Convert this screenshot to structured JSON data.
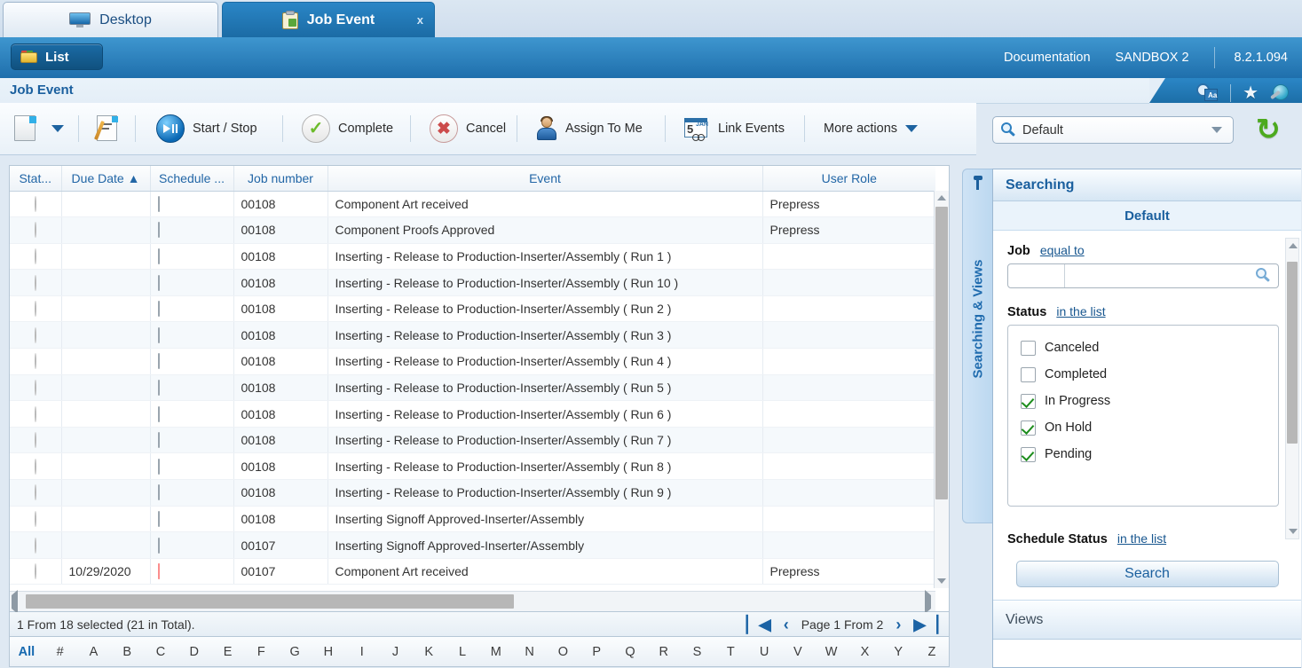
{
  "tabs": [
    {
      "label": "Desktop",
      "icon": "monitor-icon",
      "active": false
    },
    {
      "label": "Job Event",
      "icon": "clipboard-icon",
      "active": true,
      "close": "x"
    }
  ],
  "header": {
    "list_button": "List",
    "documentation": "Documentation",
    "environment": "SANDBOX 2",
    "version": "8.2.1.094",
    "page_title": "Job Event"
  },
  "toolbar": {
    "new_dropdown": "▼",
    "items": [
      {
        "label": "Start / Stop",
        "icon": "start-stop-icon"
      },
      {
        "label": "Complete",
        "icon": "check-circle-icon"
      },
      {
        "label": "Cancel",
        "icon": "cancel-circle-icon"
      },
      {
        "label": "Assign To Me",
        "icon": "user-icon"
      },
      {
        "label": "Link Events",
        "icon": "calendar-link-icon"
      },
      {
        "label": "More actions",
        "icon": "chevron-down-icon"
      }
    ]
  },
  "view_selector": {
    "value": "Default",
    "icon": "magnifier-icon"
  },
  "grid": {
    "columns": [
      {
        "key": "status",
        "label": "Stat...",
        "sorted": false
      },
      {
        "key": "due_date",
        "label": "Due Date",
        "sorted": true,
        "sort_arrow": "▲"
      },
      {
        "key": "schedule",
        "label": "Schedule ...",
        "sorted": false
      },
      {
        "key": "job_number",
        "label": "Job number",
        "sorted": false
      },
      {
        "key": "event",
        "label": "Event",
        "sorted": false
      },
      {
        "key": "user_role",
        "label": "User Role",
        "sorted": false
      }
    ],
    "rows": [
      {
        "status": "",
        "due_date": "",
        "schedule": "empty",
        "job_number": "00108",
        "event": "Component Art received",
        "user_role": "Prepress"
      },
      {
        "status": "",
        "due_date": "",
        "schedule": "empty",
        "job_number": "00108",
        "event": "Component Proofs Approved",
        "user_role": "Prepress"
      },
      {
        "status": "",
        "due_date": "",
        "schedule": "empty",
        "job_number": "00108",
        "event": "Inserting - Release to Production-Inserter/Assembly ( Run 1 )",
        "user_role": ""
      },
      {
        "status": "",
        "due_date": "",
        "schedule": "empty",
        "job_number": "00108",
        "event": "Inserting - Release to Production-Inserter/Assembly ( Run 10 )",
        "user_role": ""
      },
      {
        "status": "",
        "due_date": "",
        "schedule": "empty",
        "job_number": "00108",
        "event": "Inserting - Release to Production-Inserter/Assembly ( Run 2 )",
        "user_role": ""
      },
      {
        "status": "",
        "due_date": "",
        "schedule": "empty",
        "job_number": "00108",
        "event": "Inserting - Release to Production-Inserter/Assembly ( Run 3 )",
        "user_role": ""
      },
      {
        "status": "",
        "due_date": "",
        "schedule": "empty",
        "job_number": "00108",
        "event": "Inserting - Release to Production-Inserter/Assembly ( Run 4 )",
        "user_role": ""
      },
      {
        "status": "",
        "due_date": "",
        "schedule": "empty",
        "job_number": "00108",
        "event": "Inserting - Release to Production-Inserter/Assembly ( Run 5 )",
        "user_role": ""
      },
      {
        "status": "",
        "due_date": "",
        "schedule": "empty",
        "job_number": "00108",
        "event": "Inserting - Release to Production-Inserter/Assembly ( Run 6 )",
        "user_role": ""
      },
      {
        "status": "",
        "due_date": "",
        "schedule": "empty",
        "job_number": "00108",
        "event": "Inserting - Release to Production-Inserter/Assembly ( Run 7 )",
        "user_role": ""
      },
      {
        "status": "",
        "due_date": "",
        "schedule": "empty",
        "job_number": "00108",
        "event": "Inserting - Release to Production-Inserter/Assembly ( Run 8 )",
        "user_role": ""
      },
      {
        "status": "",
        "due_date": "",
        "schedule": "empty",
        "job_number": "00108",
        "event": "Inserting - Release to Production-Inserter/Assembly ( Run 9 )",
        "user_role": ""
      },
      {
        "status": "",
        "due_date": "",
        "schedule": "empty",
        "job_number": "00108",
        "event": "Inserting Signoff Approved-Inserter/Assembly",
        "user_role": ""
      },
      {
        "status": "",
        "due_date": "",
        "schedule": "empty",
        "job_number": "00107",
        "event": "Inserting Signoff Approved-Inserter/Assembly",
        "user_role": ""
      },
      {
        "status": "",
        "due_date": "10/29/2020",
        "schedule": "red",
        "job_number": "00107",
        "event": "Component Art received",
        "user_role": "Prepress"
      }
    ]
  },
  "status_bar": {
    "info": "1 From 18 selected (21 in Total).",
    "page_label": "Page 1 From 2",
    "first": "▏◀",
    "prev": "‹",
    "next": "›",
    "last": "▶▕"
  },
  "alpha_filter": {
    "selected": "All",
    "letters": [
      "All",
      "#",
      "A",
      "B",
      "C",
      "D",
      "E",
      "F",
      "G",
      "H",
      "I",
      "J",
      "K",
      "L",
      "M",
      "N",
      "O",
      "P",
      "Q",
      "R",
      "S",
      "T",
      "U",
      "V",
      "W",
      "X",
      "Y",
      "Z"
    ]
  },
  "side_tab": {
    "label": "Searching & Views",
    "pin_icon": "pin-icon"
  },
  "search_panel": {
    "section_title": "Searching",
    "view_name": "Default",
    "criteria": [
      {
        "label": "Job",
        "operator": "equal to",
        "type": "text",
        "value": ""
      },
      {
        "label": "Status",
        "operator": "in the list",
        "type": "checklist",
        "options": [
          {
            "label": "Canceled",
            "checked": false
          },
          {
            "label": "Completed",
            "checked": false
          },
          {
            "label": "In Progress",
            "checked": true
          },
          {
            "label": "On Hold",
            "checked": true
          },
          {
            "label": "Pending",
            "checked": true
          }
        ]
      },
      {
        "label": "Schedule Status",
        "operator": "in the list",
        "type": "checklist",
        "options": []
      }
    ],
    "search_button": "Search",
    "views_title": "Views"
  },
  "colors": {
    "accent_blue": "#1f6fac",
    "tab_active": "#2a86c6",
    "link_blue": "#17568f",
    "overdue_red": "#fb8d8d",
    "check_green": "#1d8d1d"
  }
}
